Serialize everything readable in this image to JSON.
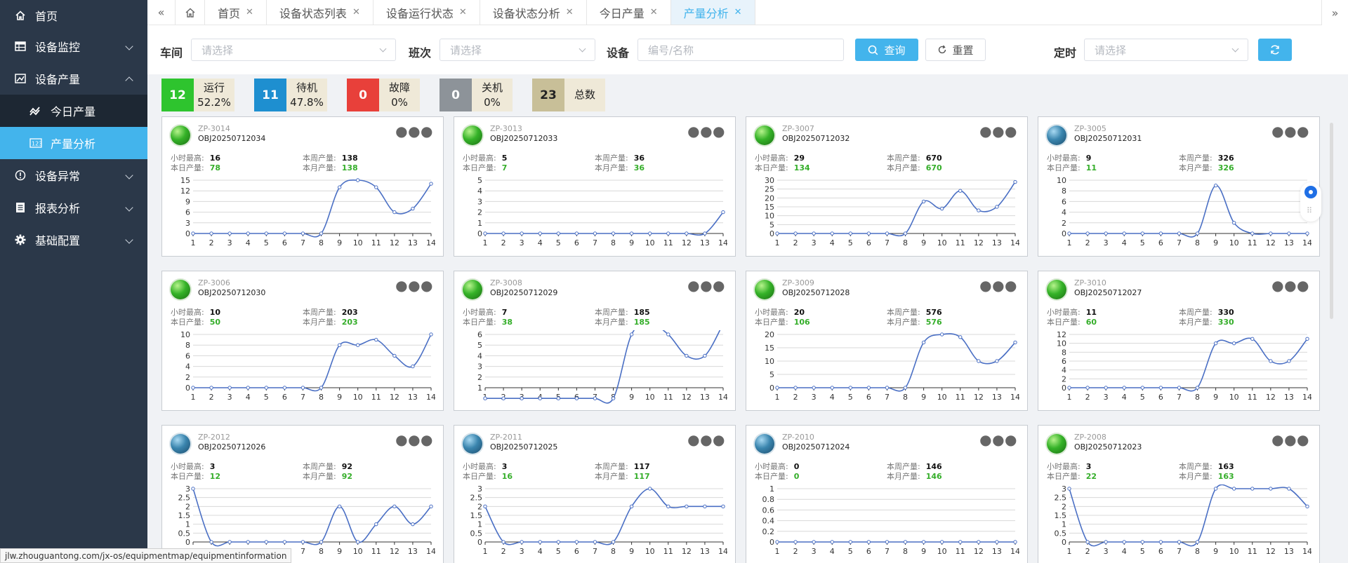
{
  "sidebar": {
    "items": [
      {
        "label": "首页",
        "icon": "home-icon"
      },
      {
        "label": "设备监控",
        "icon": "table-icon"
      },
      {
        "label": "设备产量",
        "icon": "chart-icon"
      },
      {
        "label": "设备异常",
        "icon": "info-icon"
      },
      {
        "label": "报表分析",
        "icon": "document-icon"
      },
      {
        "label": "基础配置",
        "icon": "gear-icon"
      }
    ],
    "subitems": [
      {
        "label": "今日产量",
        "icon": "trend-icon"
      },
      {
        "label": "产量分析",
        "icon": "number-icon"
      }
    ]
  },
  "tabs": [
    "首页",
    "设备状态列表",
    "设备运行状态",
    "设备状态分析",
    "今日产量",
    "产量分析"
  ],
  "filter": {
    "workshop_label": "车间",
    "workshop_placeholder": "请选择",
    "shift_label": "班次",
    "shift_placeholder": "请选择",
    "device_label": "设备",
    "device_placeholder": "编号/名称",
    "query_label": "查询",
    "reset_label": "重置",
    "timer_label": "定时",
    "timer_placeholder": "请选择"
  },
  "status": [
    {
      "count": "12",
      "label": "运行",
      "pct": "52.2%",
      "color": "#2ec42e"
    },
    {
      "count": "11",
      "label": "待机",
      "pct": "47.8%",
      "color": "#1e8fd0"
    },
    {
      "count": "0",
      "label": "故障",
      "pct": "0%",
      "color": "#e8403a"
    },
    {
      "count": "0",
      "label": "关机",
      "pct": "0%",
      "color": "#8d9399"
    },
    {
      "count": "23",
      "label": "总数",
      "pct": "",
      "color": "#c8bf98"
    }
  ],
  "card_labels": {
    "hour_max": "小时最高:",
    "week": "本周产量:",
    "today": "本日产量:",
    "month": "本月产量:"
  },
  "cards": [
    {
      "id": "ZP-3014",
      "obj": "OBJ20250712034",
      "status": "green",
      "hour_max": "16",
      "week": "138",
      "today": "78",
      "month": "138",
      "yticks": [
        0,
        3,
        6,
        9,
        12,
        15
      ],
      "y": [
        0,
        0,
        0,
        0,
        0,
        0,
        0,
        0,
        13,
        15,
        13,
        6,
        7,
        14
      ]
    },
    {
      "id": "ZP-3013",
      "obj": "OBJ20250712033",
      "status": "green",
      "hour_max": "5",
      "week": "36",
      "today": "7",
      "month": "36",
      "yticks": [
        0,
        1,
        2,
        3,
        4,
        5
      ],
      "y": [
        0,
        0,
        0,
        0,
        0,
        0,
        0,
        0,
        0,
        0,
        0,
        0,
        0,
        2
      ]
    },
    {
      "id": "ZP-3007",
      "obj": "OBJ20250712032",
      "status": "green",
      "hour_max": "29",
      "week": "670",
      "today": "134",
      "month": "670",
      "yticks": [
        0,
        5,
        10,
        15,
        20,
        25,
        30
      ],
      "y": [
        0,
        0,
        0,
        0,
        0,
        0,
        0,
        0,
        18,
        14,
        24,
        13,
        15,
        29
      ]
    },
    {
      "id": "ZP-3005",
      "obj": "OBJ20250712031",
      "status": "blue",
      "hour_max": "9",
      "week": "326",
      "today": "11",
      "month": "326",
      "yticks": [
        0,
        2,
        4,
        6,
        8,
        10
      ],
      "y": [
        0,
        0,
        0,
        0,
        0,
        0,
        0,
        0,
        9,
        2,
        0,
        0,
        0,
        0
      ]
    },
    {
      "id": "ZP-3006",
      "obj": "OBJ20250712030",
      "status": "green",
      "hour_max": "10",
      "week": "203",
      "today": "50",
      "month": "203",
      "yticks": [
        0,
        2,
        4,
        6,
        8,
        10
      ],
      "y": [
        0,
        0,
        0,
        0,
        0,
        0,
        0,
        0,
        8,
        8,
        9,
        6,
        4,
        10
      ]
    },
    {
      "id": "ZP-3008",
      "obj": "OBJ20250712029",
      "status": "green",
      "hour_max": "7",
      "week": "185",
      "today": "38",
      "month": "185",
      "yticks": [
        1,
        2,
        3,
        4,
        5,
        6
      ],
      "y": [
        0,
        0,
        0,
        0,
        0,
        0,
        0,
        0,
        6,
        7,
        6,
        4,
        4,
        7
      ]
    },
    {
      "id": "ZP-3009",
      "obj": "OBJ20250712028",
      "status": "green",
      "hour_max": "20",
      "week": "576",
      "today": "106",
      "month": "576",
      "yticks": [
        0,
        5,
        10,
        15,
        20
      ],
      "y": [
        0,
        0,
        0,
        0,
        0,
        0,
        0,
        0,
        17,
        20,
        19,
        10,
        10,
        17
      ]
    },
    {
      "id": "ZP-3010",
      "obj": "OBJ20250712027",
      "status": "green",
      "hour_max": "11",
      "week": "330",
      "today": "60",
      "month": "330",
      "yticks": [
        0,
        2,
        4,
        6,
        8,
        10,
        12
      ],
      "y": [
        0,
        0,
        0,
        0,
        0,
        0,
        0,
        0,
        10,
        10,
        11,
        6,
        6,
        11
      ]
    },
    {
      "id": "ZP-2012",
      "obj": "OBJ20250712026",
      "status": "blue",
      "hour_max": "3",
      "week": "92",
      "today": "12",
      "month": "92",
      "yticks": [
        0,
        0.5,
        1,
        1.5,
        2,
        2.5,
        3
      ],
      "y": [
        3,
        0,
        0,
        0,
        0,
        0,
        0,
        0,
        2,
        0,
        1,
        2,
        1,
        2
      ]
    },
    {
      "id": "ZP-2011",
      "obj": "OBJ20250712025",
      "status": "blue",
      "hour_max": "3",
      "week": "117",
      "today": "16",
      "month": "117",
      "yticks": [
        0,
        0.5,
        1,
        1.5,
        2,
        2.5,
        3
      ],
      "y": [
        2,
        0,
        0,
        0,
        0,
        0,
        0,
        0,
        2,
        3,
        2,
        2,
        2,
        2
      ]
    },
    {
      "id": "ZP-2010",
      "obj": "OBJ20250712024",
      "status": "blue",
      "hour_max": "0",
      "week": "146",
      "today": "0",
      "month": "146",
      "yticks": [
        0,
        0.2,
        0.4,
        0.6,
        0.8,
        1
      ],
      "y": [
        0,
        0,
        0,
        0,
        0,
        0,
        0,
        0,
        0,
        0,
        0,
        0,
        0,
        0
      ]
    },
    {
      "id": "ZP-2008",
      "obj": "OBJ20250712023",
      "status": "green",
      "hour_max": "3",
      "week": "163",
      "today": "22",
      "month": "163",
      "yticks": [
        0,
        0.5,
        1,
        1.5,
        2,
        2.5,
        3
      ],
      "y": [
        3,
        0,
        0,
        0,
        0,
        0,
        0,
        0,
        3,
        3,
        3,
        3,
        3,
        2
      ]
    }
  ],
  "chart_x": [
    1,
    2,
    3,
    4,
    5,
    6,
    7,
    8,
    9,
    10,
    11,
    12,
    13,
    14
  ],
  "status_url": "jlw.zhouguantong.com/jx-os/equipmentmap/equipmentinformation",
  "colors": {
    "accent": "#43b4ec",
    "line": "#4a6fc4",
    "sidebar": "#2b3849"
  }
}
